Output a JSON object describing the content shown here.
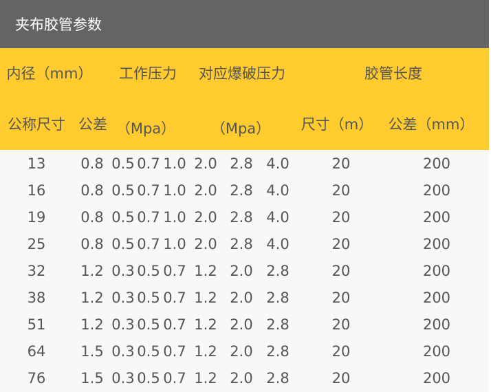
{
  "title": "夹布胶管参数",
  "header": {
    "row1": {
      "inner_diameter": "内径（mm）",
      "working_pressure": "工作压力",
      "burst_pressure": "对应爆破压力",
      "hose_length": "胶管长度"
    },
    "row2": {
      "nominal_size": "公称尺寸",
      "tolerance": "公差",
      "wp_unit": "（Mpa）",
      "bp_unit": "（Mpa）",
      "length_size": "尺寸（m）",
      "length_tolerance": "公差（mm）"
    }
  },
  "rows": [
    [
      "13",
      "0.8",
      "0.5",
      "0.7",
      "1.0",
      "2.0",
      "2.8",
      "4.0",
      "20",
      "200"
    ],
    [
      "16",
      "0.8",
      "0.5",
      "0.7",
      "1.0",
      "2.0",
      "2.8",
      "4.0",
      "20",
      "200"
    ],
    [
      "19",
      "0.8",
      "0.5",
      "0.7",
      "1.0",
      "2.0",
      "2.8",
      "4.0",
      "20",
      "200"
    ],
    [
      "25",
      "0.8",
      "0.5",
      "0.7",
      "1.0",
      "2.0",
      "2.8",
      "4.0",
      "20",
      "200"
    ],
    [
      "32",
      "1.2",
      "0.3",
      "0.5",
      "0.7",
      "1.2",
      "2.0",
      "2.8",
      "20",
      "200"
    ],
    [
      "38",
      "1.2",
      "0.3",
      "0.5",
      "0.7",
      "1.2",
      "2.0",
      "2.8",
      "20",
      "200"
    ],
    [
      "51",
      "1.2",
      "0.3",
      "0.5",
      "0.7",
      "1.2",
      "2.0",
      "2.8",
      "20",
      "200"
    ],
    [
      "64",
      "1.5",
      "0.3",
      "0.5",
      "0.7",
      "1.2",
      "2.0",
      "2.8",
      "20",
      "200"
    ],
    [
      "76",
      "1.5",
      "0.3",
      "0.5",
      "0.7",
      "1.2",
      "2.0",
      "2.8",
      "20",
      "200"
    ]
  ]
}
